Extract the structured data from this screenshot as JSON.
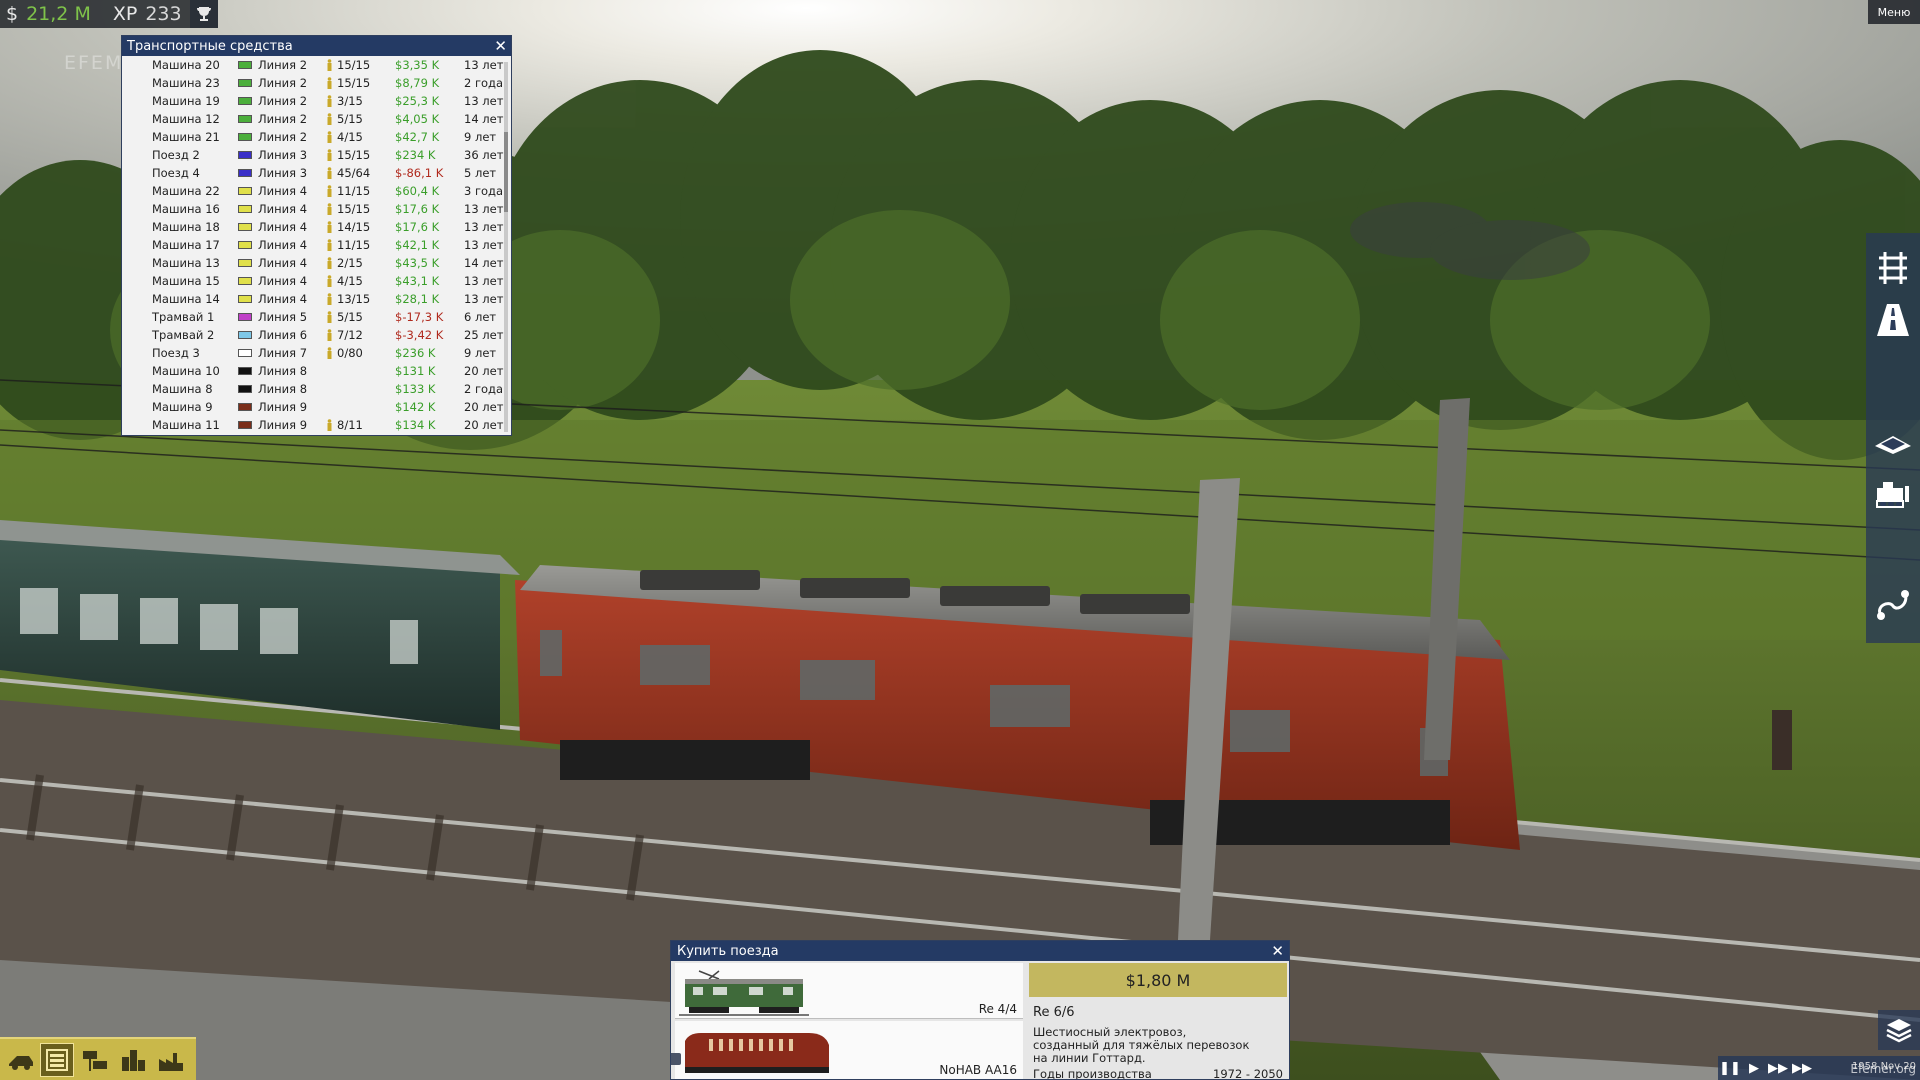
{
  "hud": {
    "money_sign": "$",
    "money": "21,2 M",
    "xp_label": "XP",
    "xp": "233",
    "trophy_icon": "trophy-icon",
    "menu": "Меню"
  },
  "watermark_top": "EFEMER.ORG",
  "watermark_bottom": "Efemer.org",
  "vehicles_window": {
    "title": "Транспортные средства",
    "rows": [
      {
        "name": "Машина 20",
        "line": "Линия 2",
        "color": "#4caf3c",
        "load": "15/15",
        "profit": "$3,35 K",
        "neg": false,
        "age": "13 лет"
      },
      {
        "name": "Машина 23",
        "line": "Линия 2",
        "color": "#4caf3c",
        "load": "15/15",
        "profit": "$8,79 K",
        "neg": false,
        "age": "2 года"
      },
      {
        "name": "Машина 19",
        "line": "Линия 2",
        "color": "#4caf3c",
        "load": "3/15",
        "profit": "$25,3 K",
        "neg": false,
        "age": "13 лет"
      },
      {
        "name": "Машина 12",
        "line": "Линия 2",
        "color": "#4caf3c",
        "load": "5/15",
        "profit": "$4,05 K",
        "neg": false,
        "age": "14 лет"
      },
      {
        "name": "Машина 21",
        "line": "Линия 2",
        "color": "#4caf3c",
        "load": "4/15",
        "profit": "$42,7 K",
        "neg": false,
        "age": "9 лет"
      },
      {
        "name": "Поезд 2",
        "line": "Линия 3",
        "color": "#3a2fc8",
        "load": "15/15",
        "profit": "$234 K",
        "neg": false,
        "age": "36 лет"
      },
      {
        "name": "Поезд 4",
        "line": "Линия 3",
        "color": "#3a2fc8",
        "load": "45/64",
        "profit": "$-86,1 K",
        "neg": true,
        "age": "5 лет"
      },
      {
        "name": "Машина 22",
        "line": "Линия 4",
        "color": "#e0e04a",
        "load": "11/15",
        "profit": "$60,4 K",
        "neg": false,
        "age": "3 года"
      },
      {
        "name": "Машина 16",
        "line": "Линия 4",
        "color": "#e0e04a",
        "load": "15/15",
        "profit": "$17,6 K",
        "neg": false,
        "age": "13 лет"
      },
      {
        "name": "Машина 18",
        "line": "Линия 4",
        "color": "#e0e04a",
        "load": "14/15",
        "profit": "$17,6 K",
        "neg": false,
        "age": "13 лет"
      },
      {
        "name": "Машина 17",
        "line": "Линия 4",
        "color": "#e0e04a",
        "load": "11/15",
        "profit": "$42,1 K",
        "neg": false,
        "age": "13 лет"
      },
      {
        "name": "Машина 13",
        "line": "Линия 4",
        "color": "#e0e04a",
        "load": "2/15",
        "profit": "$43,5 K",
        "neg": false,
        "age": "14 лет"
      },
      {
        "name": "Машина 15",
        "line": "Линия 4",
        "color": "#e0e04a",
        "load": "4/15",
        "profit": "$43,1 K",
        "neg": false,
        "age": "13 лет"
      },
      {
        "name": "Машина 14",
        "line": "Линия 4",
        "color": "#e0e04a",
        "load": "13/15",
        "profit": "$28,1 K",
        "neg": false,
        "age": "13 лет"
      },
      {
        "name": "Трамвай 1",
        "line": "Линия 5",
        "color": "#c040c8",
        "load": "5/15",
        "profit": "$-17,3 K",
        "neg": true,
        "age": "6 лет"
      },
      {
        "name": "Трамвай 2",
        "line": "Линия 6",
        "color": "#7ec8e8",
        "load": "7/12",
        "profit": "$-3,42 K",
        "neg": true,
        "age": "25 лет"
      },
      {
        "name": "Поезд 3",
        "line": "Линия 7",
        "color": "#ffffff",
        "load": "0/80",
        "profit": "$236 K",
        "neg": false,
        "age": "9 лет"
      },
      {
        "name": "Машина 10",
        "line": "Линия 8",
        "color": "#111111",
        "load": "",
        "profit": "$131 K",
        "neg": false,
        "age": "20 лет"
      },
      {
        "name": "Машина 8",
        "line": "Линия 8",
        "color": "#111111",
        "load": "",
        "profit": "$133 K",
        "neg": false,
        "age": "2 года"
      },
      {
        "name": "Машина 9",
        "line": "Линия 9",
        "color": "#7a2e1a",
        "load": "",
        "profit": "$142 K",
        "neg": false,
        "age": "20 лет"
      },
      {
        "name": "Машина 11",
        "line": "Линия 9",
        "color": "#7a2e1a",
        "load": "8/11",
        "profit": "$134 K",
        "neg": false,
        "age": "20 лет"
      }
    ]
  },
  "right_toolbar": [
    "rail-track-icon",
    "road-icon",
    "terrain-icon",
    "bulldozer-icon",
    "lines-icon"
  ],
  "bottom_toolbar": [
    "vehicle-icon",
    "depot-icon",
    "station-icon",
    "city-icon",
    "industry-icon"
  ],
  "buy_dialog": {
    "title": "Купить поезда",
    "trains": [
      {
        "name": "Re 4/4",
        "color": "#3f6a3a"
      },
      {
        "name": "NoHAB AA16",
        "color": "#8a2a1a"
      }
    ],
    "price": "$1,80 M",
    "model": "Re 6/6",
    "description_lines": [
      "Шестиосный электровоз,",
      "созданный для тяжёлых перевозок",
      "на линии Готтард."
    ],
    "years_label": "Годы производства",
    "years_value": "1972 - 2050"
  },
  "speed": {
    "date": "1958 Nov 20"
  },
  "colors": {
    "window_title": "#243a64",
    "profit_positive": "#3a9e2a",
    "profit_negative": "#b02a1e",
    "toolbar_gold": "#c9b84a",
    "locomotive_red": "#9e3320"
  }
}
